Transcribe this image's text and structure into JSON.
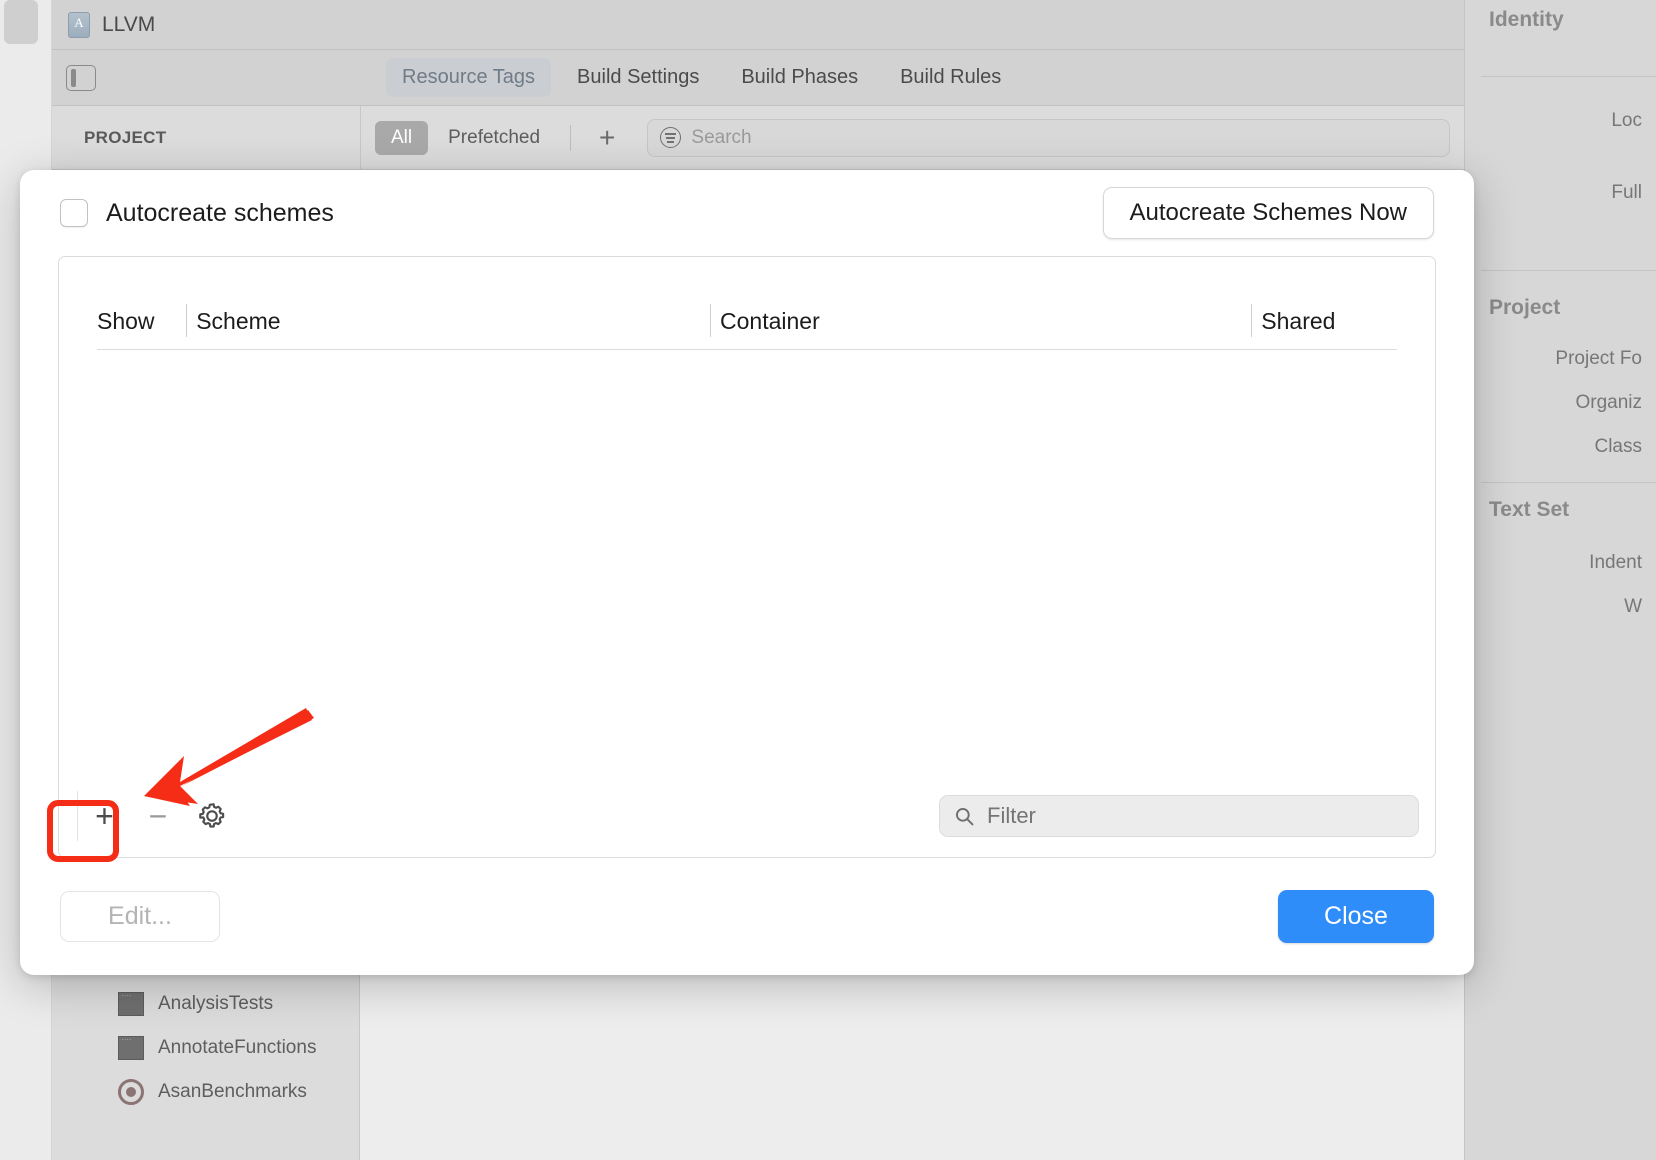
{
  "window": {
    "project_name": "LLVM",
    "project_icon": "xcode-project-icon"
  },
  "tabs": [
    {
      "label": "Resource Tags",
      "active": true
    },
    {
      "label": "Build Settings",
      "active": false
    },
    {
      "label": "Build Phases",
      "active": false
    },
    {
      "label": "Build Rules",
      "active": false
    }
  ],
  "subbar": {
    "section_label": "PROJECT",
    "segments": [
      {
        "label": "All",
        "selected": true
      },
      {
        "label": "Prefetched",
        "selected": false
      }
    ],
    "add_label": "+",
    "search_placeholder": "Search"
  },
  "navigator": {
    "items": [
      {
        "label": "AnalysisTests",
        "icon": "source-file-icon"
      },
      {
        "label": "AnnotateFunctions",
        "icon": "source-file-icon"
      },
      {
        "label": "AsanBenchmarks",
        "icon": "target-icon"
      }
    ]
  },
  "inspector": {
    "sections": [
      {
        "label": "Identity",
        "type": "header"
      },
      {
        "label": "Loc",
        "type": "row"
      },
      {
        "label": "Full",
        "type": "row"
      },
      {
        "label": "Project",
        "type": "header"
      },
      {
        "label": "Project Fo",
        "type": "row"
      },
      {
        "label": "Organiz",
        "type": "row"
      },
      {
        "label": "Class",
        "type": "row"
      },
      {
        "label": "Text Set",
        "type": "header"
      },
      {
        "label": "Indent",
        "type": "row"
      },
      {
        "label": "W",
        "type": "row"
      }
    ]
  },
  "sheet": {
    "autocreate_checkbox_label": "Autocreate schemes",
    "autocreate_checked": false,
    "autocreate_now_button": "Autocreate Schemes Now",
    "table": {
      "columns": [
        "Show",
        "Scheme",
        "Container",
        "Shared"
      ],
      "rows": []
    },
    "toolbar": {
      "add_label": "+",
      "remove_label": "−",
      "settings_icon": "gear-icon",
      "filter_placeholder": "Filter",
      "filter_value": "",
      "filter_icon": "search-icon"
    },
    "edit_button": "Edit...",
    "close_button": "Close"
  },
  "annotations": {
    "highlight_color": "#f52d17",
    "arrow_color": "#f52d17",
    "highlight_target": "add-scheme-button"
  }
}
